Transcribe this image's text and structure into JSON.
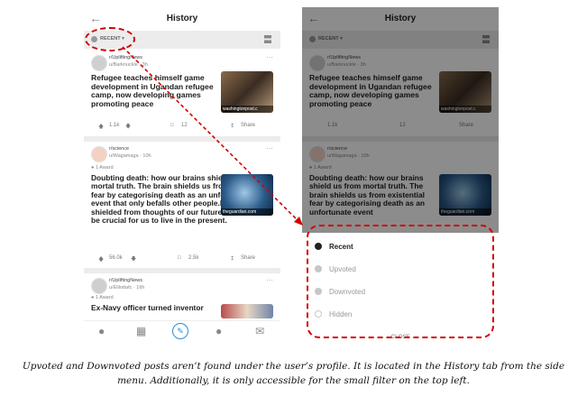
{
  "screen": {
    "title": "History",
    "filter_label": "RECENT",
    "posts": [
      {
        "subreddit": "r/UpliftingNews",
        "user": "u/Barknuckle · 3h",
        "award": "",
        "title": "Refugee teaches himself game development in Ugandan refugee camp, now developing games promoting peace",
        "thumb_caption": "washingtonpost.c",
        "votes": "1.1k",
        "comments": "12",
        "share": "Share"
      },
      {
        "subreddit": "r/science",
        "user": "u/Wagamaga · 10h",
        "award": "1 Award",
        "title": "Doubting death: how our brains shield us from mortal truth. The brain shields us from existential fear by categorising death as an unfortunate event that only befalls other people.Being shielded from thoughts of our future death could be crucial for us to live in the present.",
        "thumb_caption": "theguardian.com",
        "votes": "56.0k",
        "comments": "2.5k",
        "share": "Share"
      },
      {
        "subreddit": "r/UpliftingNews",
        "user": "u/Elliottafc · 16h",
        "award": "1 Award",
        "title": "Ex-Navy officer turned inventor"
      }
    ],
    "nav_icons": [
      "home-icon",
      "communities-icon",
      "post-icon",
      "chat-icon",
      "inbox-icon"
    ]
  },
  "sheet": {
    "options": [
      {
        "label": "Recent",
        "selected": true
      },
      {
        "label": "Upvoted",
        "selected": false
      },
      {
        "label": "Downvoted",
        "selected": false
      },
      {
        "label": "Hidden",
        "selected": false
      }
    ],
    "close_label": "CLOSE"
  },
  "caption": "Upvoted and Downvoted posts aren’t found under the user’s profile. It is located in the History tab from the side menu. Additionally, it is only accessible for the small filter on the top left.",
  "colors": {
    "annotation": "#d10000",
    "selected_option": "#222222",
    "overlay": "#7a7a7a"
  }
}
